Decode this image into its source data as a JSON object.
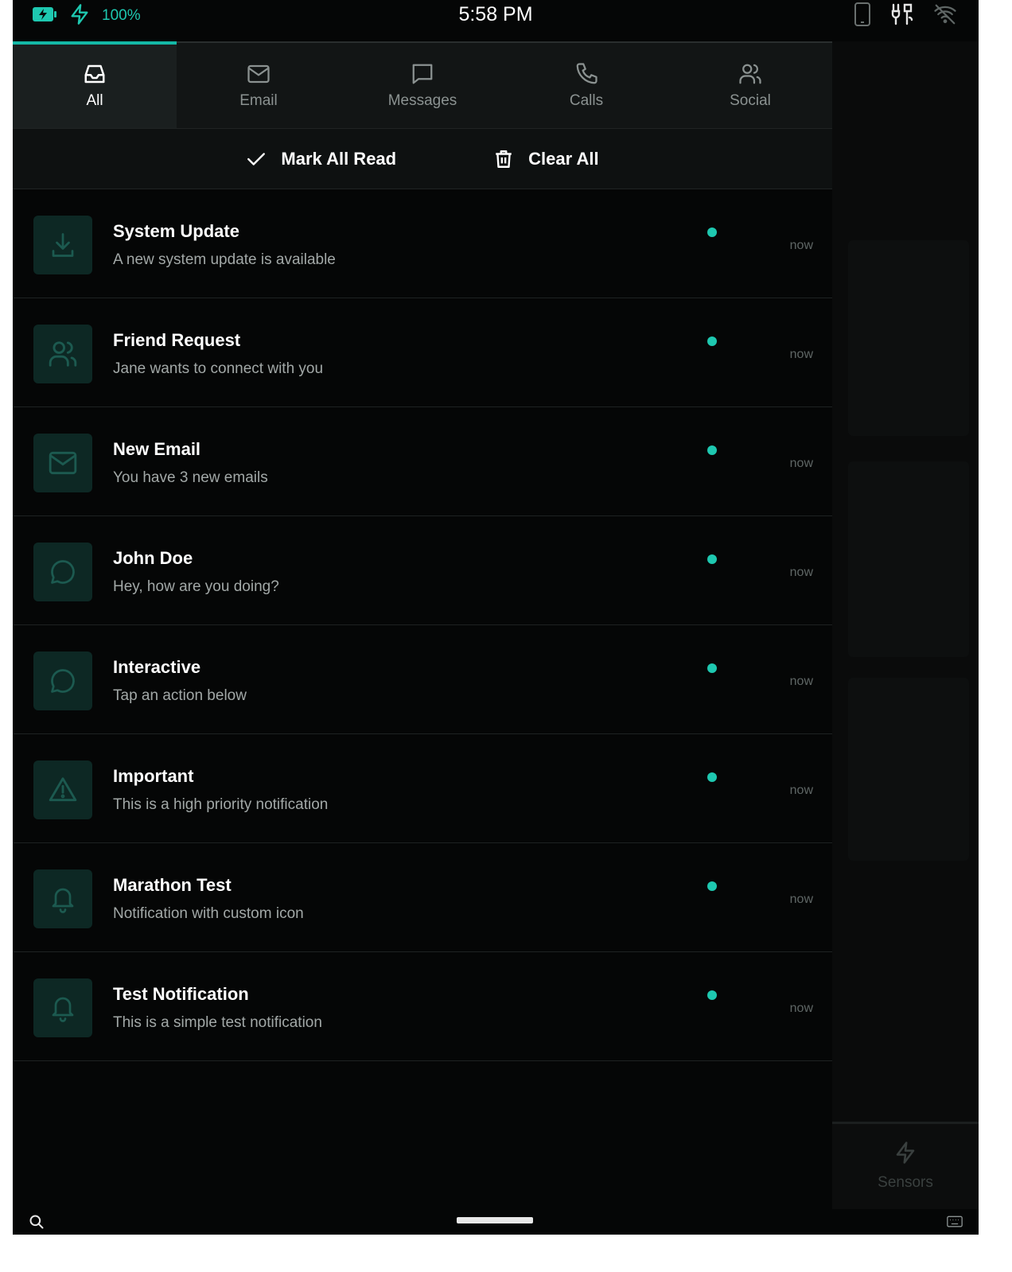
{
  "status_bar": {
    "battery_percent": "100%",
    "time": "5:58 PM"
  },
  "tabs": [
    {
      "label": "All",
      "icon": "inbox-icon",
      "active": true
    },
    {
      "label": "Email",
      "icon": "mail-icon",
      "active": false
    },
    {
      "label": "Messages",
      "icon": "message-icon",
      "active": false
    },
    {
      "label": "Calls",
      "icon": "phone-icon",
      "active": false
    },
    {
      "label": "Social",
      "icon": "users-icon",
      "active": false
    }
  ],
  "actions": {
    "mark_all_read": "Mark All Read",
    "clear_all": "Clear All"
  },
  "notifications": [
    {
      "title": "System Update",
      "body": "A new system update is available",
      "time": "now",
      "icon": "download-icon"
    },
    {
      "title": "Friend Request",
      "body": "Jane wants to connect with you",
      "time": "now",
      "icon": "users-icon"
    },
    {
      "title": "New Email",
      "body": "You have 3 new emails",
      "time": "now",
      "icon": "mail-icon"
    },
    {
      "title": "John Doe",
      "body": "Hey, how are you doing?",
      "time": "now",
      "icon": "message-icon"
    },
    {
      "title": "Interactive",
      "body": "Tap an action below",
      "time": "now",
      "icon": "message-icon"
    },
    {
      "title": "Important",
      "body": "This is a high priority notification",
      "time": "now",
      "icon": "warning-icon"
    },
    {
      "title": "Marathon Test",
      "body": "Notification with custom icon",
      "time": "now",
      "icon": "bell-icon"
    },
    {
      "title": "Test Notification",
      "body": "This is a simple test notification",
      "time": "now",
      "icon": "bell-icon"
    }
  ],
  "side_panel": {
    "sensors_label": "Sensors"
  },
  "colors": {
    "accent": "#14b8a6",
    "background": "#050606",
    "unread_dot": "#1ec8b0"
  }
}
